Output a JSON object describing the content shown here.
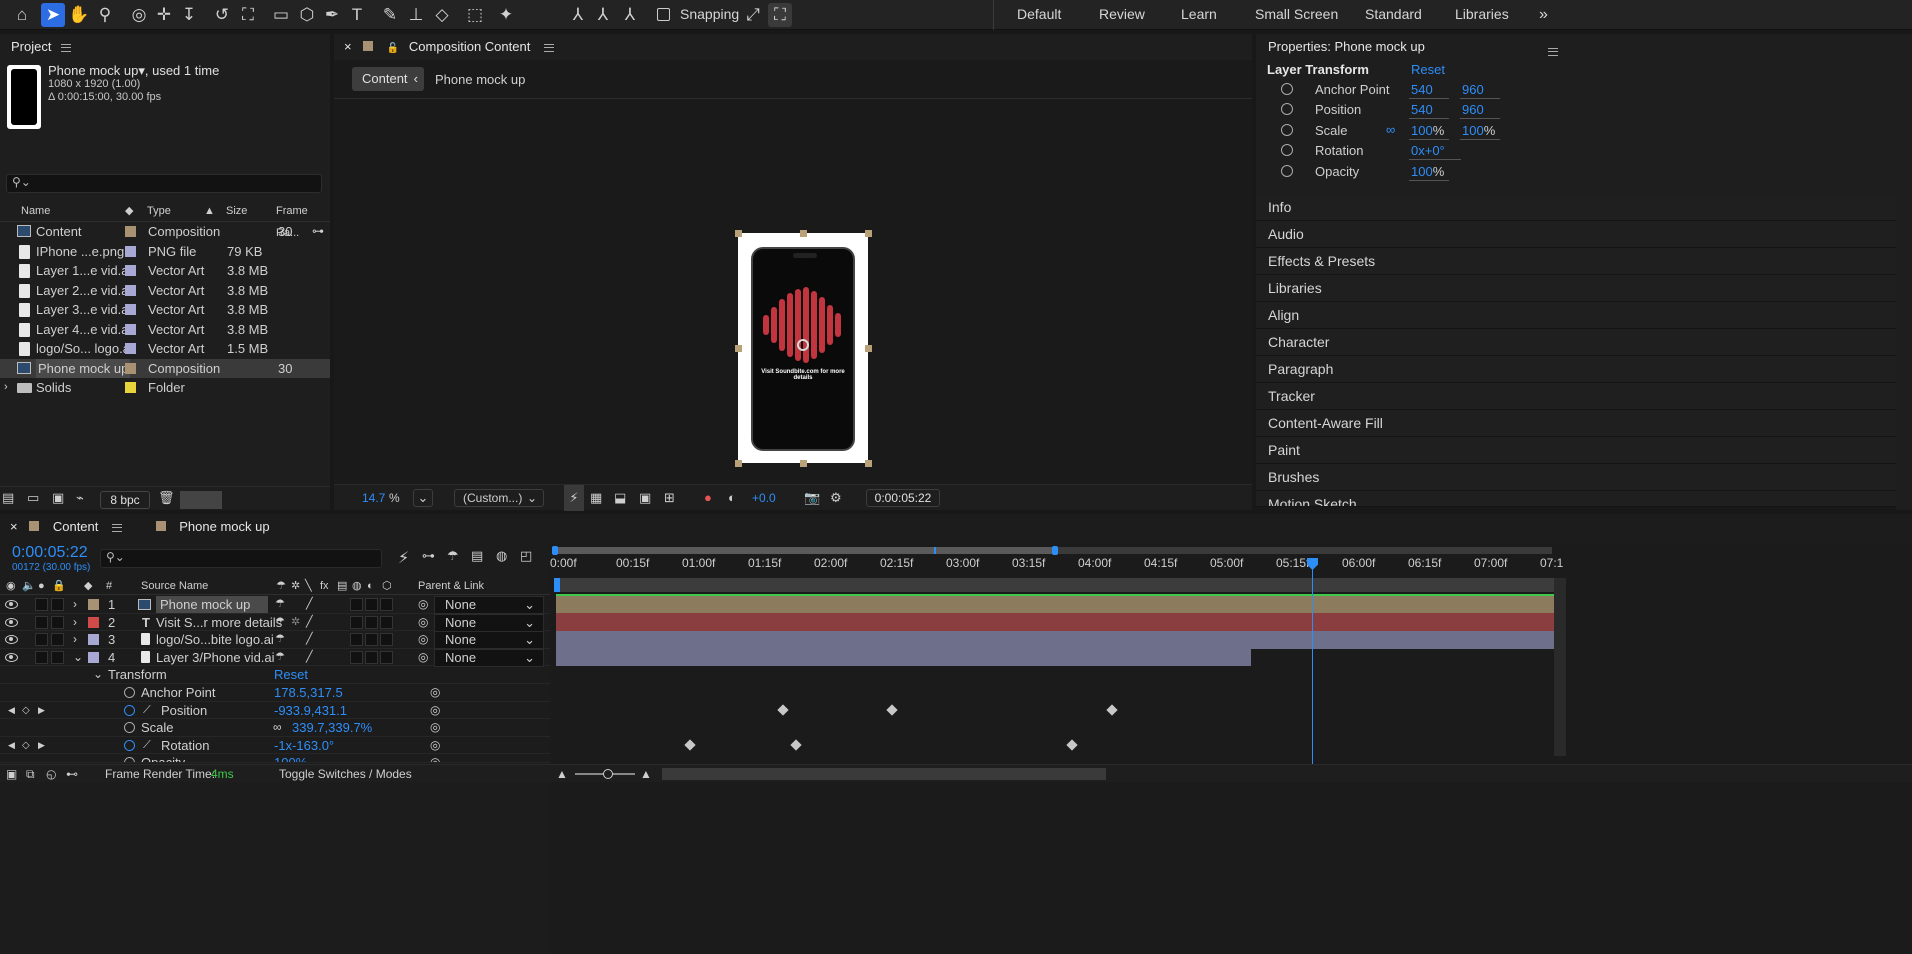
{
  "toolbar": {
    "snapping_label": "Snapping"
  },
  "workspaces": [
    "Default",
    "Review",
    "Learn",
    "Small Screen",
    "Standard",
    "Libraries"
  ],
  "project": {
    "panel_title": "Project",
    "selected_name": "Phone mock up",
    "selected_used": ", used 1 time",
    "selected_dims": "1080 x 1920 (1.00)",
    "selected_duration": "Δ 0:00:15:00, 30.00 fps",
    "columns": {
      "name": "Name",
      "type": "Type",
      "size": "Size",
      "frame_rate": "Frame Ra..."
    },
    "items": [
      {
        "name": "Content",
        "type": "Composition",
        "size": "",
        "fps": "30",
        "label_color": "#a99273"
      },
      {
        "name": "IPhone ...e.png",
        "type": "PNG file",
        "size": "79 KB",
        "fps": "",
        "label_color": "#a7a9d4"
      },
      {
        "name": "Layer 1...e vid.ai",
        "type": "Vector Art",
        "size": "3.8 MB",
        "fps": "",
        "label_color": "#a7a9d4"
      },
      {
        "name": "Layer 2...e vid.ai",
        "type": "Vector Art",
        "size": "3.8 MB",
        "fps": "",
        "label_color": "#a7a9d4"
      },
      {
        "name": "Layer 3...e vid.ai",
        "type": "Vector Art",
        "size": "3.8 MB",
        "fps": "",
        "label_color": "#a7a9d4"
      },
      {
        "name": "Layer 4...e vid.ai",
        "type": "Vector Art",
        "size": "3.8 MB",
        "fps": "",
        "label_color": "#a7a9d4"
      },
      {
        "name": "logo/So... logo.ai",
        "type": "Vector Art",
        "size": "1.5 MB",
        "fps": "",
        "label_color": "#a7a9d4"
      },
      {
        "name": "Phone mock up",
        "type": "Composition",
        "size": "",
        "fps": "30",
        "label_color": "#a99273"
      },
      {
        "name": "Solids",
        "type": "Folder",
        "size": "",
        "fps": "",
        "label_color": "#e6d43a"
      }
    ],
    "bpc": "8 bpc"
  },
  "composition": {
    "panel_title": "Composition Content",
    "crumb_active": "Content",
    "crumb_next": "Phone mock up",
    "phone_text": "Visit Soundbite.com for more details",
    "zoom": "14.7",
    "zoom_unit": "%",
    "resolution": "(Custom...)",
    "exposure": "+0.0",
    "timecode": "0:00:05:22"
  },
  "properties": {
    "title": "Properties: Phone mock up",
    "section": "Layer Transform",
    "reset": "Reset",
    "anchor_label": "Anchor Point",
    "anchor_x": "540",
    "anchor_y": "960",
    "position_label": "Position",
    "position_x": "540",
    "position_y": "960",
    "scale_label": "Scale",
    "scale_x": "100",
    "scale_y": "100",
    "pct": "%",
    "rotation_label": "Rotation",
    "rotation_val": "0x+0°",
    "opacity_label": "Opacity",
    "opacity_val": "100"
  },
  "panels": [
    "Info",
    "Audio",
    "Effects & Presets",
    "Libraries",
    "Align",
    "Character",
    "Paragraph",
    "Tracker",
    "Content-Aware Fill",
    "Paint",
    "Brushes",
    "Motion Sketch"
  ],
  "timeline": {
    "tab_active": "Content",
    "tab_other": "Phone mock up",
    "current_time": "0:00:05:22",
    "frame_info": "00172 (30.00 fps)",
    "col_source": "Source Name",
    "col_parent": "Parent & Link",
    "ticks": [
      "0:00f",
      "00:15f",
      "01:00f",
      "01:15f",
      "02:00f",
      "02:15f",
      "03:00f",
      "03:15f",
      "04:00f",
      "04:15f",
      "05:00f",
      "05:15f",
      "06:00f",
      "06:15f",
      "07:00f",
      "07:1"
    ],
    "layers": [
      {
        "num": "1",
        "name": "Phone mock up",
        "parent": "None",
        "color": "#a99273"
      },
      {
        "num": "2",
        "name": "Visit S...r more details",
        "parent": "None",
        "color": "#d04a4a"
      },
      {
        "num": "3",
        "name": "logo/So...bite logo.ai",
        "parent": "None",
        "color": "#a7a9d4"
      },
      {
        "num": "4",
        "name": "Layer 3/Phone vid.ai",
        "parent": "None",
        "color": "#a7a9d4"
      }
    ],
    "transform_label": "Transform",
    "transform_reset": "Reset",
    "props": [
      {
        "name": "Anchor Point",
        "value": "178.5,317.5"
      },
      {
        "name": "Position",
        "value": "-933.9,431.1"
      },
      {
        "name": "Scale",
        "value": "339.7,339.7%"
      },
      {
        "name": "Rotation",
        "value": "-1x-163.0°"
      },
      {
        "name": "Opacity",
        "value": "100%"
      }
    ],
    "render_label": "Frame Render Time:",
    "render_value": "4ms",
    "toggle_label": "Toggle Switches / Modes"
  }
}
